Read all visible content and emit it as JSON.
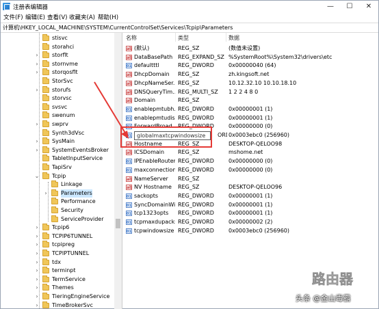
{
  "window": {
    "title": "注册表编辑器",
    "controls": {
      "minimize": "—",
      "maximize": "☐",
      "close": "✕"
    }
  },
  "menu": [
    "文件(F)",
    "编辑(E)",
    "查看(V)",
    "收藏夹(A)",
    "帮助(H)"
  ],
  "address": "计算机\\HKEY_LOCAL_MACHINE\\SYSTEM\\CurrentControlSet\\Services\\Tcpip\\Parameters",
  "tree": {
    "items": [
      {
        "label": "stisvc"
      },
      {
        "label": "storahci"
      },
      {
        "label": "storflt"
      },
      {
        "label": "stornvme"
      },
      {
        "label": "storqosflt"
      },
      {
        "label": "StorSvc"
      },
      {
        "label": "storufs"
      },
      {
        "label": "storvsc"
      },
      {
        "label": "svsvc"
      },
      {
        "label": "swenum"
      },
      {
        "label": "swprv"
      },
      {
        "label": "Synth3dVsc"
      },
      {
        "label": "SysMain"
      },
      {
        "label": "SystemEventsBroker"
      },
      {
        "label": "TabletInputService"
      },
      {
        "label": "TapiSrv"
      },
      {
        "label": "Tcpip"
      },
      {
        "label": "Linkage"
      },
      {
        "label": "Parameters"
      },
      {
        "label": "Performance"
      },
      {
        "label": "Security"
      },
      {
        "label": "ServiceProvider"
      },
      {
        "label": "Tcpip6"
      },
      {
        "label": "TCPIP6TUNNEL"
      },
      {
        "label": "tcpipreg"
      },
      {
        "label": "TCPIPTUNNEL"
      },
      {
        "label": "tdx"
      },
      {
        "label": "terminpt"
      },
      {
        "label": "TermService"
      },
      {
        "label": "Themes"
      },
      {
        "label": "TieringEngineService"
      },
      {
        "label": "TimeBrokerSvc"
      }
    ]
  },
  "list": {
    "headers": {
      "name": "名称",
      "type": "类型",
      "data": "数据"
    },
    "rows": [
      {
        "icon": "ab",
        "name": "(默认)",
        "type": "REG_SZ",
        "data": "(数值未设置)"
      },
      {
        "icon": "ab",
        "name": "DataBasePath",
        "type": "REG_EXPAND_SZ",
        "data": "%SystemRoot%\\System32\\drivers\\etc"
      },
      {
        "icon": "bin",
        "name": "defaultttl",
        "type": "REG_DWORD",
        "data": "0x00000040 (64)"
      },
      {
        "icon": "ab",
        "name": "DhcpDomain",
        "type": "REG_SZ",
        "data": "zh.kingsoft.net"
      },
      {
        "icon": "ab",
        "name": "DhcpNameSer...",
        "type": "REG_SZ",
        "data": "10.12.32.10 10.10.18.10"
      },
      {
        "icon": "ab",
        "name": "DNSQueryTim...",
        "type": "REG_MULTI_SZ",
        "data": "1 2 2 4 8 0"
      },
      {
        "icon": "ab",
        "name": "Domain",
        "type": "REG_SZ",
        "data": ""
      },
      {
        "icon": "bin",
        "name": "enablepmtubh...",
        "type": "REG_DWORD",
        "data": "0x00000001 (1)"
      },
      {
        "icon": "bin",
        "name": "enablepmtudis...",
        "type": "REG_DWORD",
        "data": "0x00000001 (1)"
      },
      {
        "icon": "bin",
        "name": "ForwardBroad...",
        "type": "REG_DWORD",
        "data": "0x00000000 (0)"
      },
      {
        "icon": "bin",
        "name": "",
        "type": "ORD",
        "data": "0x0003ebc0 (256960)"
      },
      {
        "icon": "ab",
        "name": "Hostname",
        "type": "REG_SZ",
        "data": "DESKTOP-QELOO98"
      },
      {
        "icon": "ab",
        "name": "ICSDomain",
        "type": "REG_SZ",
        "data": "mshome.net"
      },
      {
        "icon": "bin",
        "name": "IPEnableRouter",
        "type": "REG_DWORD",
        "data": "0x00000000 (0)"
      },
      {
        "icon": "bin",
        "name": "maxconnection...",
        "type": "REG_DWORD",
        "data": "0x00000000 (0)"
      },
      {
        "icon": "ab",
        "name": "NameServer",
        "type": "REG_SZ",
        "data": ""
      },
      {
        "icon": "ab",
        "name": "NV Hostname",
        "type": "REG_SZ",
        "data": "DESKTOP-QELOO96"
      },
      {
        "icon": "bin",
        "name": "sackopts",
        "type": "REG_DWORD",
        "data": "0x00000001 (1)"
      },
      {
        "icon": "bin",
        "name": "SyncDomainWi...",
        "type": "REG_DWORD",
        "data": "0x00000001 (1)"
      },
      {
        "icon": "bin",
        "name": "tcp1323opts",
        "type": "REG_DWORD",
        "data": "0x00000001 (1)"
      },
      {
        "icon": "bin",
        "name": "tcpmaxdupacks",
        "type": "REG_DWORD",
        "data": "0x00000002 (2)"
      },
      {
        "icon": "bin",
        "name": "tcpwindowsize",
        "type": "REG_DWORD",
        "data": "0x0003ebc0 (256960)"
      }
    ],
    "editing_value": "globalmaxtcpwindowsize"
  },
  "annotation": {
    "color": "#e53935"
  },
  "watermark": {
    "brand": "路由器",
    "credit": "头条 @金山毒霸"
  }
}
